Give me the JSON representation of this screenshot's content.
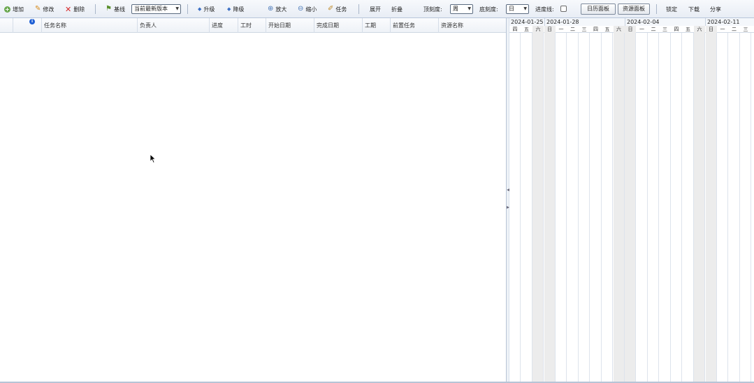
{
  "toolbar": {
    "add": "增加",
    "edit": "修改",
    "delete": "删除",
    "baseline": "基线",
    "version_select": "当前最新版本",
    "upgrade": "升级",
    "downgrade": "降级",
    "zoom_in": "放大",
    "zoom_out": "缩小",
    "task": "任务",
    "expand": "展开",
    "collapse": "折叠",
    "top_scale_label": "顶刻度:",
    "top_scale_value": "周",
    "bottom_scale_label": "底刻度:",
    "bottom_scale_value": "日",
    "progress_line_label": "进度线:",
    "calendar_panel": "日历面板",
    "resource_panel": "资源面板",
    "lock": "锁定",
    "download": "下载",
    "share": "分享"
  },
  "grid": {
    "columns": [
      "任务名称",
      "负责人",
      "进度",
      "工时",
      "开始日期",
      "完成日期",
      "工期",
      "前置任务",
      "资源名称"
    ]
  },
  "gantt": {
    "weeks": [
      "2024-01-25",
      "2024-01-28",
      "2024-02-04",
      "2024-02-11"
    ],
    "days": [
      "四",
      "五",
      "六",
      "日",
      "一",
      "二",
      "三",
      "四",
      "五",
      "六",
      "日",
      "一",
      "二",
      "三",
      "四",
      "五",
      "六",
      "日",
      "一",
      "二",
      "三"
    ],
    "weekend_color": "#ececec"
  },
  "colors": {
    "toolbar_bg": "#e8edf5",
    "border": "#b7c4d6",
    "info_icon": "#1e5fd4"
  }
}
